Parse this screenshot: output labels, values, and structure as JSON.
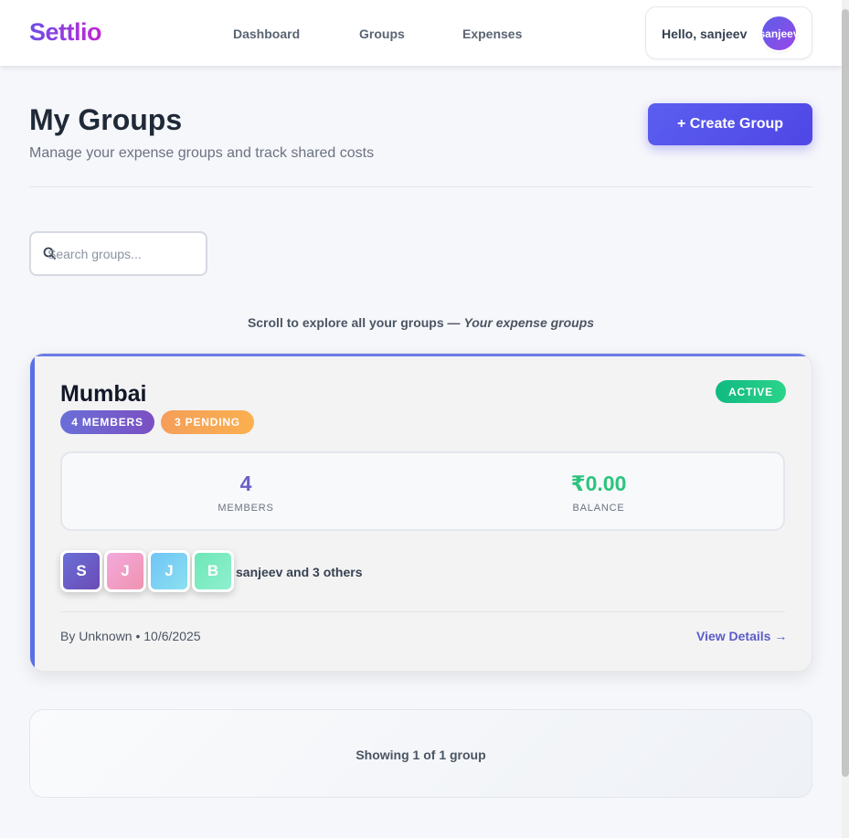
{
  "header": {
    "brand": "Settlio",
    "nav": [
      {
        "label": "Dashboard"
      },
      {
        "label": "Groups"
      },
      {
        "label": "Expenses"
      }
    ],
    "greeting": "Hello, sanjeev",
    "avatar_text": "sanjeev"
  },
  "page": {
    "title": "My Groups",
    "subtitle": "Manage your expense groups and track shared costs",
    "create_button": "+ Create Group"
  },
  "search": {
    "placeholder": "Search groups...",
    "value": ""
  },
  "hint": {
    "text": "Scroll to explore all your groups — ",
    "emphasis": "Your expense groups"
  },
  "group": {
    "name": "Mumbai",
    "status": "ACTIVE",
    "members_pill": "4 MEMBERS",
    "pending_pill": "3 PENDING",
    "stats": {
      "members_value": "4",
      "members_label": "MEMBERS",
      "balance_value": "₹0.00",
      "balance_label": "BALANCE"
    },
    "avatars": [
      {
        "initial": "S",
        "color": "#6b5fc8"
      },
      {
        "initial": "J",
        "color": "#f0a2cf"
      },
      {
        "initial": "J",
        "color": "#7fd2f2"
      },
      {
        "initial": "B",
        "color": "#7ee8bd"
      }
    ],
    "members_text": "sanjeev and 3 others",
    "meta": "By Unknown • 10/6/2025",
    "view_link": "View Details →"
  },
  "summary": {
    "text": "Showing 1 of 1 group"
  },
  "colors": {
    "primary": "#4f46e5",
    "accent_purple": "#6b5fc8",
    "success": "#10b981",
    "pending": "#f59e5a"
  }
}
